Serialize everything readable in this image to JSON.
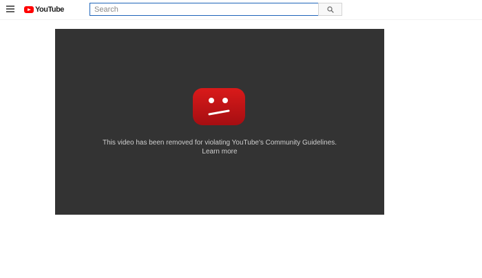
{
  "header": {
    "logo_text": "YouTube",
    "search_placeholder": "Search",
    "search_value": "",
    "icons": {
      "menu": "hamburger-menu-icon",
      "logo": "youtube-logo-icon",
      "search": "search-icon"
    }
  },
  "player": {
    "error_message": "This video has been removed for violating YouTube's Community Guidelines.",
    "learn_more_label": "Learn more",
    "icon": "sad-face-icon"
  },
  "colors": {
    "brand_red": "#ff0000",
    "player_bg": "#333333",
    "error_icon_red": "#c4111b",
    "search_border": "#1c62b9"
  }
}
